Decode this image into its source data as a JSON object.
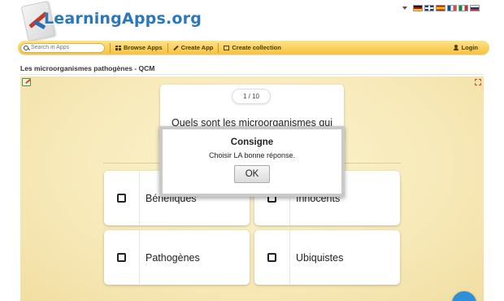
{
  "header": {
    "logo_text": "LearningApps.org",
    "flags": [
      "de",
      "gb",
      "es",
      "fr",
      "it",
      "ru"
    ]
  },
  "nav": {
    "search_placeholder": "Search in Apps",
    "browse_label": "Browse Apps",
    "create_label": "Create App",
    "collection_label": "Create collection",
    "login_label": "Login"
  },
  "app": {
    "title": "Les microorganismes pathogènes - QCM"
  },
  "quiz": {
    "counter": "1 / 10",
    "question": "Quels sont les microorganismes qui",
    "answers": [
      "Bénéfiques",
      "Innocents",
      "Pathogènes",
      "Ubiquistes"
    ]
  },
  "modal": {
    "title": "Consigne",
    "text": "Choisir LA bonne réponse.",
    "ok_label": "OK"
  },
  "colors": {
    "navbar": "#f5c23c",
    "logo": "#2a78b8",
    "stage": "#f7e9b8",
    "fab": "#2f8fd8"
  }
}
